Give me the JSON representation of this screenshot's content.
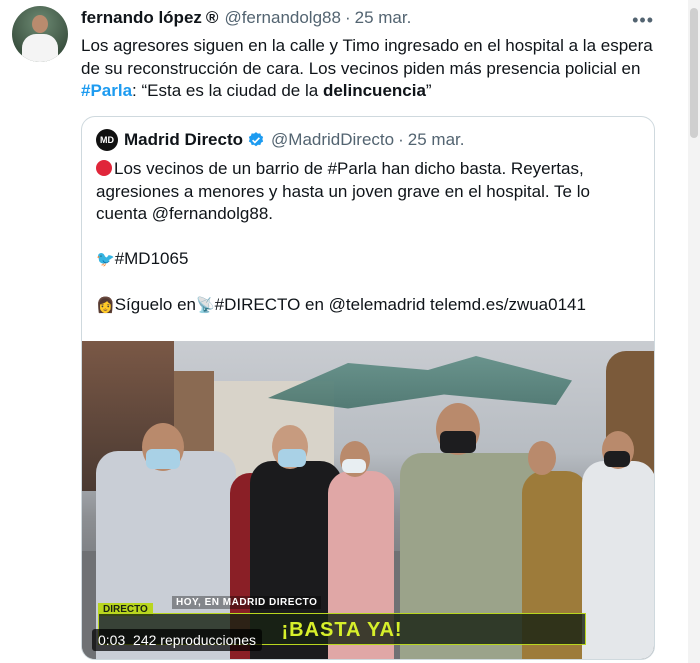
{
  "tweet": {
    "author_name": "fernando lópez",
    "author_badge": "®",
    "author_handle": "@fernandolg88",
    "separator": "·",
    "date": "25 mar.",
    "more_icon": "more-icon",
    "text_part1": "Los agresores siguen en la calle y Timo ingresado en el hospital a la espera de su reconstrucción de cara. Los vecinos piden más presencia policial en ",
    "hashtag": "#Parla",
    "text_part2": ": “Esta es la ciudad de la ",
    "bold_word": "delincuencia",
    "text_part3": "”"
  },
  "quote": {
    "avatar_label": "MD",
    "author_name": "Madrid Directo",
    "verified_icon": "verified-icon",
    "author_handle": "@MadridDirecto",
    "separator": "·",
    "date": "25 mar.",
    "line1": "Los vecinos de un barrio de #Parla han dicho basta. Reyertas, agresiones a menores y hasta un joven grave en el hospital. Te lo cuenta @fernandolg88.",
    "line2": "#MD1065",
    "line3_prefix": "Síguelo en",
    "line3_rest": "#DIRECTO en @telemadrid telemd.es/zwua0141"
  },
  "video": {
    "overlay_caption": "HOY, EN MADRID DIRECTO",
    "live_tag": "DIRECTO",
    "banner_text": "¡BASTA YA!",
    "time": "0:03",
    "views": "242 reproducciones"
  },
  "colors": {
    "link_blue": "#1d9bf0",
    "muted_gray": "#536471",
    "banner_green": "#d7ef2b"
  }
}
